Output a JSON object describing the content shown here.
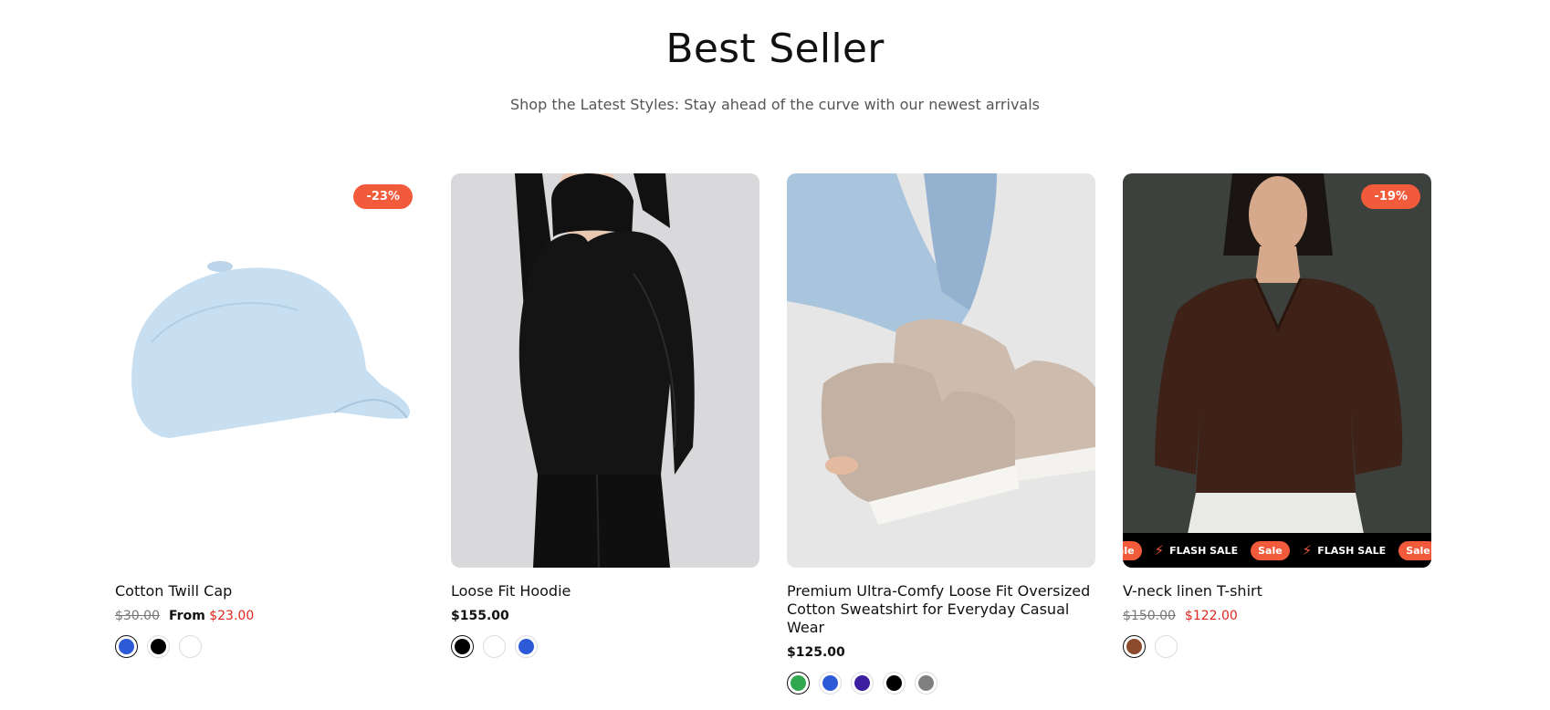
{
  "section": {
    "title": "Best Seller",
    "subtitle": "Shop the Latest Styles: Stay ahead of the curve with our newest arrivals"
  },
  "products": [
    {
      "name": "Cotton Twill Cap",
      "badge": "-23%",
      "old_price": "$30.00",
      "from_label": "From",
      "price": "$23.00",
      "image": "light-blue-cap",
      "swatches": [
        "#2d5bd7",
        "#000000",
        "#ffffff"
      ],
      "selected_swatch": 0
    },
    {
      "name": "Loose Fit Hoodie",
      "price": "$155.00",
      "image": "black-hoodie",
      "swatches": [
        "#000000",
        "#ffffff",
        "#2d5bd7"
      ],
      "selected_swatch": 0
    },
    {
      "name": "Premium Ultra-Comfy Loose Fit Oversized Cotton Sweatshirt for Everyday Casual Wear",
      "price": "$125.00",
      "image": "beige-slip-on-shoes",
      "swatches": [
        "#2fa84f",
        "#2d5bd7",
        "#3a1fa0",
        "#000000",
        "#808080"
      ],
      "selected_swatch": 0
    },
    {
      "name": "V-neck linen T-shirt",
      "badge": "-19%",
      "old_price": "$150.00",
      "price": "$122.00",
      "image": "brown-vneck-tshirt",
      "swatches": [
        "#8b4a2b",
        "#ffffff"
      ],
      "selected_swatch": 0,
      "marquee": {
        "sale": "Sale",
        "flash": "FLASH SALE",
        "bolt_icon": "lightning-icon"
      }
    }
  ],
  "colors": {
    "accent": "#f15a3b",
    "sale_price": "#e1261c"
  }
}
